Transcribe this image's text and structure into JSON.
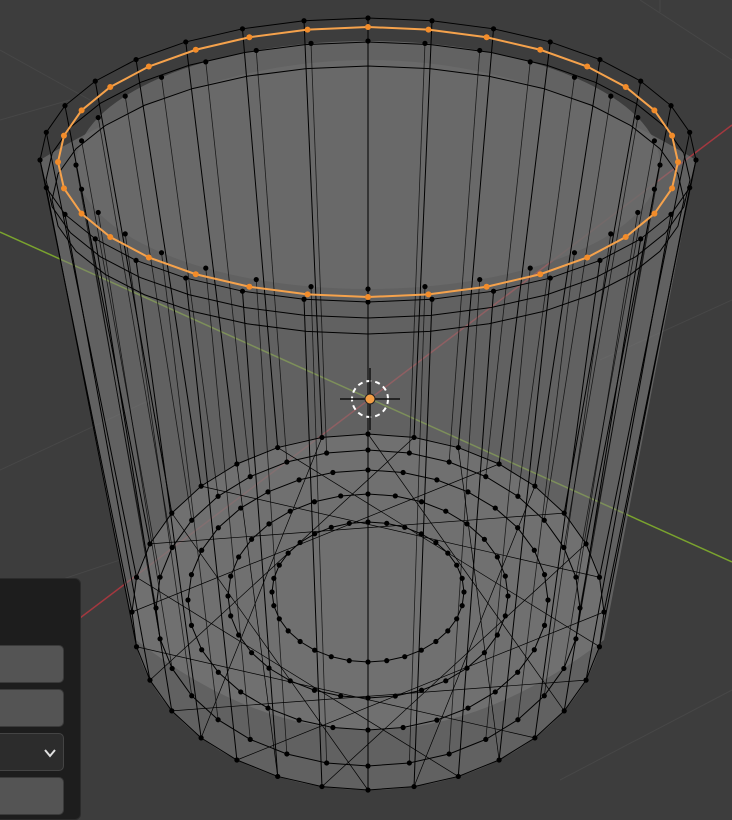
{
  "viewport": {
    "background": "#3d3d3d",
    "axis_x_color": "#a3383f",
    "axis_y_color": "#7aa32e",
    "mesh_face_color": "#808080",
    "wire_color": "#000000",
    "selected_edge_color": "#f5a24c",
    "selected_vertex_color": "#f28c2a",
    "object_origin_color": "#f29d45"
  },
  "operator_panel": {
    "rows": [
      {
        "label": ""
      },
      {
        "label": ""
      },
      {
        "label": "",
        "has_dropdown": true,
        "icon": "chevron-down-icon"
      },
      {
        "label": ""
      }
    ]
  }
}
